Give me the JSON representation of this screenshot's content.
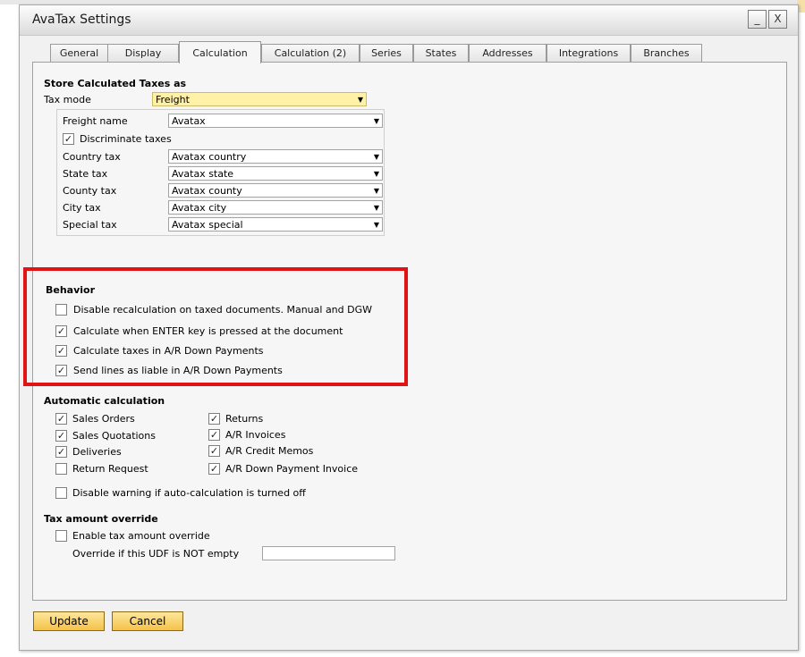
{
  "window": {
    "title": "AvaTax Settings",
    "minimize_glyph": "_",
    "close_glyph": "X"
  },
  "tabs": [
    {
      "label": "General"
    },
    {
      "label": "Display"
    },
    {
      "label": "Calculation",
      "active": true
    },
    {
      "label": "Calculation (2)"
    },
    {
      "label": "Series"
    },
    {
      "label": "States"
    },
    {
      "label": "Addresses"
    },
    {
      "label": "Integrations"
    },
    {
      "label": "Branches"
    }
  ],
  "store": {
    "title": "Store Calculated Taxes as",
    "tax_mode_label": "Tax mode",
    "tax_mode_value": "Freight",
    "freight_name_label": "Freight name",
    "freight_name_value": "Avatax",
    "discriminate_label": "Discriminate taxes",
    "discriminate_checked": true,
    "fields": [
      {
        "label": "Country tax",
        "value": "Avatax country"
      },
      {
        "label": "State tax",
        "value": "Avatax state"
      },
      {
        "label": "County tax",
        "value": "Avatax county"
      },
      {
        "label": "City tax",
        "value": "Avatax city"
      },
      {
        "label": "Special tax",
        "value": "Avatax special"
      }
    ]
  },
  "behavior": {
    "title": "Behavior",
    "items": [
      {
        "label": "Disable recalculation on taxed documents. Manual and DGW",
        "checked": false
      },
      {
        "label": "Calculate when ENTER key is pressed at the document",
        "checked": true
      },
      {
        "label": "Calculate taxes in A/R Down Payments",
        "checked": true
      },
      {
        "label": "Send lines as liable in A/R Down Payments",
        "checked": true
      }
    ]
  },
  "auto": {
    "title": "Automatic calculation",
    "left": [
      {
        "label": "Sales Orders",
        "checked": true
      },
      {
        "label": "Sales Quotations",
        "checked": true
      },
      {
        "label": "Deliveries",
        "checked": true
      },
      {
        "label": "Return Request",
        "checked": false
      }
    ],
    "right": [
      {
        "label": "Returns",
        "checked": true
      },
      {
        "label": "A/R Invoices",
        "checked": true
      },
      {
        "label": "A/R Credit Memos",
        "checked": true
      },
      {
        "label": "A/R Down Payment Invoice",
        "checked": true
      }
    ],
    "disable_warning_label": "Disable warning if auto-calculation is turned off",
    "disable_warning_checked": false
  },
  "override": {
    "title": "Tax amount override",
    "enable_label": "Enable tax amount override",
    "enable_checked": false,
    "udf_label": "Override if this UDF is NOT empty",
    "udf_value": ""
  },
  "buttons": {
    "update": "Update",
    "cancel": "Cancel"
  },
  "icons": {
    "dropdown": "▼",
    "check": "✓"
  },
  "colors": {
    "highlight_box": "#e01414",
    "button_fill": "#f4c24a",
    "tax_mode_fill": "#fff1a8"
  }
}
